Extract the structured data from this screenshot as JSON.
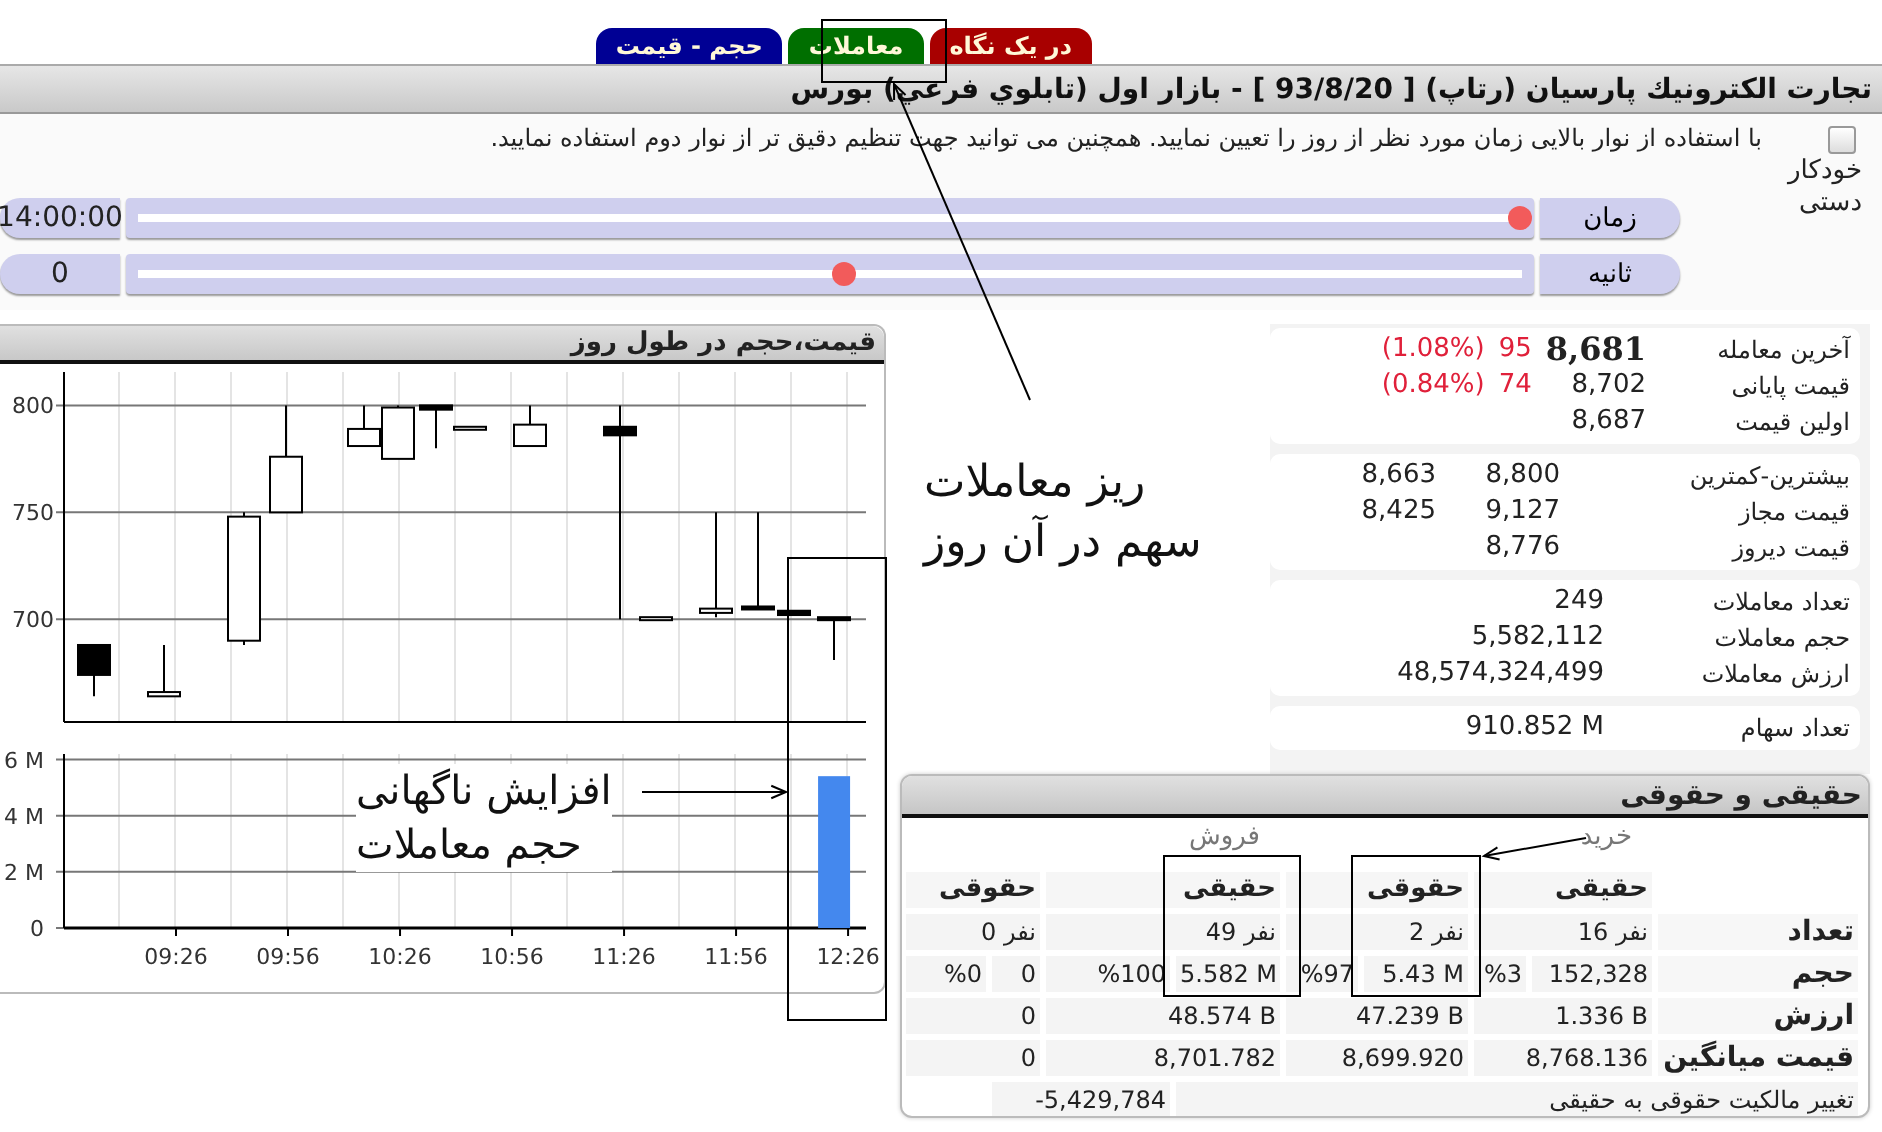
{
  "tabs": [
    {
      "label": "در یک نگاه",
      "color": "#a80000",
      "selected": false
    },
    {
      "label": "معاملات",
      "color": "#006f00",
      "selected": false
    },
    {
      "label": "حجم - قیمت",
      "color": "#000094",
      "selected": false
    }
  ],
  "header": {
    "title": "تجارت الكترونيك پارسيان (رتاپ) [ 93/8/20 ] - بازار اول (تابلوي فرعي) بورس"
  },
  "time_control": {
    "instructions": "با استفاده از نوار بالایی زمان مورد نظر از روز را تعیین نمایید. همچنین می توانید جهت تنظیم دقیق تر از نوار دوم استفاده نمایید.",
    "checkbox": {
      "checked": false,
      "labels": [
        "خودکار",
        "دستی"
      ]
    },
    "sliders": [
      {
        "label": "زمان",
        "level": 0.99,
        "value": "14:00:00"
      },
      {
        "label": "ثانیه",
        "level": 0.51,
        "value": "0"
      }
    ]
  },
  "chart_panel": {
    "title": "قیمت،حجم در طول روز",
    "annotation": [
      "افزایش ناگهانی",
      "حجم معاملات"
    ],
    "price_chart": {
      "y_labels": [
        "800",
        "750",
        "700"
      ]
    },
    "volume_chart": {
      "chart_data": {
        "type": "bar",
        "grid": true,
        "categories": [
          "09:26",
          "09:56",
          "10:26",
          "10:56",
          "11:26",
          "11:56",
          "12:26"
        ],
        "ylim": [
          0,
          6.2
        ],
        "yticks": [
          {
            "value": 0,
            "label": "0"
          },
          {
            "value": 2,
            "label": "2 M"
          },
          {
            "value": 4,
            "label": "4 M"
          },
          {
            "value": 6,
            "label": "6 M"
          }
        ],
        "series": [
          {
            "color": "#4488ee",
            "values": [
              null,
              null,
              null,
              null,
              null,
              null,
              5.41
            ]
          }
        ]
      }
    }
  },
  "annotation": {
    "lines": [
      "ریز معاملات",
      "سهم در آن روز"
    ]
  },
  "info_cards": [
    {
      "kind": "quote",
      "rows": [
        {
          "label": "آخرین معامله",
          "values": [
            {
              "kind": "last",
              "text": "8,681"
            },
            {
              "kind": "change",
              "text": "95"
            },
            {
              "kind": "change",
              "text": "(1.08%)"
            }
          ]
        },
        {
          "label": "قیمت پایانی",
          "values": [
            {
              "kind": "plain",
              "text": "8,702"
            },
            {
              "kind": "change",
              "text": "74"
            },
            {
              "kind": "change",
              "text": "(0.84%)"
            }
          ]
        },
        {
          "label": "اولین قیمت",
          "values": [
            {
              "kind": "plain",
              "text": "8,687"
            }
          ]
        }
      ]
    },
    {
      "kind": "range",
      "rows": [
        {
          "label": "بیشترین-کمترین",
          "values": [
            {
              "kind": "plain",
              "text": "8,800"
            },
            {
              "kind": "plain",
              "text": "8,663"
            }
          ]
        },
        {
          "label": "قیمت مجاز",
          "values": [
            {
              "kind": "plain",
              "text": "9,127"
            },
            {
              "kind": "plain",
              "text": "8,425"
            }
          ]
        },
        {
          "label": "قیمت دیروز",
          "values": [
            {
              "kind": "plain",
              "text": "8,776"
            }
          ]
        }
      ]
    },
    {
      "kind": "stats",
      "rows": [
        {
          "label": "تعداد معاملات",
          "values": [
            {
              "kind": "plain",
              "text": "249"
            }
          ]
        },
        {
          "label": "حجم معاملات",
          "values": [
            {
              "kind": "plain",
              "text": "5,582,112"
            }
          ]
        },
        {
          "label": "ارزش معاملات",
          "values": [
            {
              "kind": "plain",
              "text": "48,574,324,499"
            }
          ]
        }
      ]
    },
    {
      "kind": "stats",
      "rows": [
        {
          "label": "تعداد سهام",
          "values": [
            {
              "kind": "plain",
              "text": "910.852 M"
            }
          ]
        }
      ]
    }
  ],
  "split_table": {
    "title": "حقیقی و حقوقی",
    "sides": [
      "خرید",
      "فروش"
    ],
    "columns": [
      "حقیقی",
      "حقوقی",
      "حقیقی",
      "حقوقی"
    ],
    "rows": [
      {
        "label": "تعداد",
        "cells": [
          {
            "value": "16 نفر"
          },
          {
            "value": "2 نفر"
          },
          {
            "value": "49 نفر"
          },
          {
            "value": "0 نفر"
          }
        ]
      },
      {
        "label": "حجم",
        "cells": [
          {
            "value": "152,328",
            "share": "%3"
          },
          {
            "value": "5.43 M",
            "share": "%97"
          },
          {
            "value": "5.582 M",
            "share": "%100"
          },
          {
            "value": "0",
            "share": "%0"
          }
        ]
      },
      {
        "label": "ارزش",
        "cells": [
          {
            "value": "1.336 B"
          },
          {
            "value": "47.239 B"
          },
          {
            "value": "48.574 B"
          },
          {
            "value": "0"
          }
        ]
      },
      {
        "label": "قیمت میانگین",
        "cells": [
          {
            "value": "8,768.136"
          },
          {
            "value": "8,699.920"
          },
          {
            "value": "8,701.782"
          },
          {
            "value": "0"
          }
        ]
      }
    ],
    "footer": {
      "label": "تغییر مالکیت حقوقی به حقیقی",
      "value": "-5,429,784"
    }
  }
}
